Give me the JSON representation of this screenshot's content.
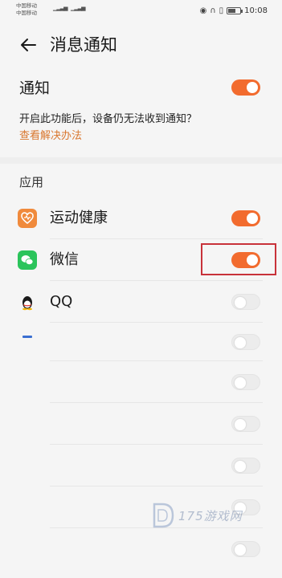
{
  "status_bar": {
    "carrier1": "中国移动",
    "carrier2": "中国移动",
    "time": "10:08"
  },
  "header": {
    "title": "消息通知",
    "back_icon": "arrow-left-icon"
  },
  "notification": {
    "label": "通知",
    "enabled": true,
    "description": "开启此功能后，设备仍无法收到通知？",
    "link": "查看解决办法"
  },
  "apps_section": {
    "title": "应用",
    "items": [
      {
        "name": "运动健康",
        "enabled": true,
        "icon": "health-icon"
      },
      {
        "name": "微信",
        "enabled": true,
        "icon": "wechat-icon"
      },
      {
        "name": "QQ",
        "enabled": false,
        "icon": "qq-icon"
      },
      {
        "name": "",
        "enabled": false,
        "icon": ""
      },
      {
        "name": "",
        "enabled": false,
        "icon": ""
      },
      {
        "name": "",
        "enabled": false,
        "icon": ""
      },
      {
        "name": "",
        "enabled": false,
        "icon": ""
      },
      {
        "name": "",
        "enabled": false,
        "icon": ""
      },
      {
        "name": "",
        "enabled": false,
        "icon": ""
      }
    ]
  },
  "watermark": {
    "text": "175游戏网"
  },
  "colors": {
    "accent": "#f26b2e",
    "link": "#d9772f",
    "highlight_box": "#c8323a"
  }
}
